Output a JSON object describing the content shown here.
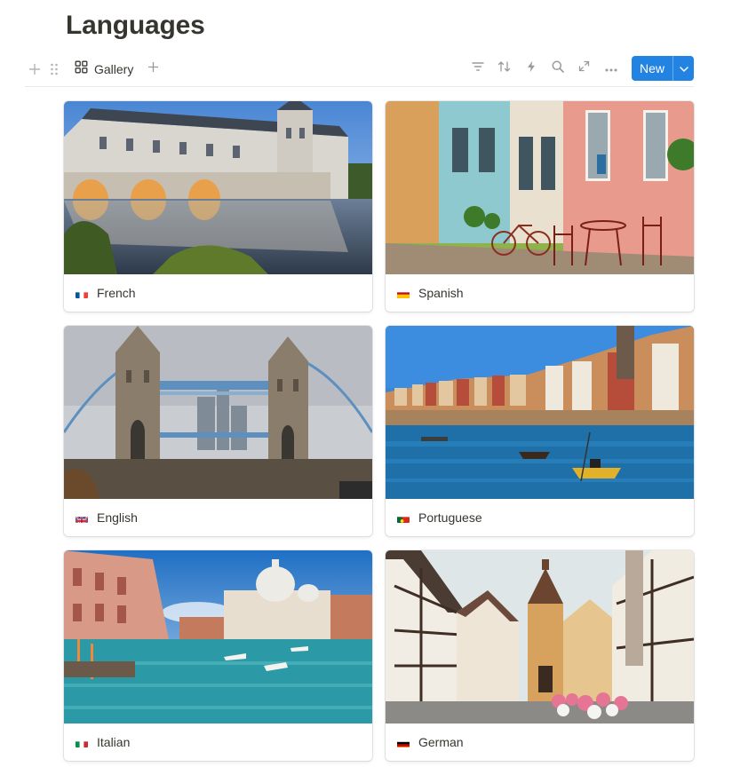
{
  "page": {
    "title": "Languages"
  },
  "toolbar": {
    "view_label": "Gallery",
    "view_icon": "gallery-grid-icon",
    "tools": [
      "filter-icon",
      "sort-icon",
      "lightning-icon",
      "search-icon",
      "expand-icon",
      "more-icon"
    ],
    "new_label": "New"
  },
  "colors": {
    "accent": "#2383e2",
    "text": "#37352f",
    "muted": "#9b9a97"
  },
  "cards": [
    {
      "title": "French",
      "flag": "flag-france-icon"
    },
    {
      "title": "Spanish",
      "flag": "flag-spain-icon"
    },
    {
      "title": "English",
      "flag": "flag-uk-icon"
    },
    {
      "title": "Portuguese",
      "flag": "flag-portugal-icon"
    },
    {
      "title": "Italian",
      "flag": "flag-italy-icon"
    },
    {
      "title": "German",
      "flag": "flag-germany-icon"
    }
  ]
}
